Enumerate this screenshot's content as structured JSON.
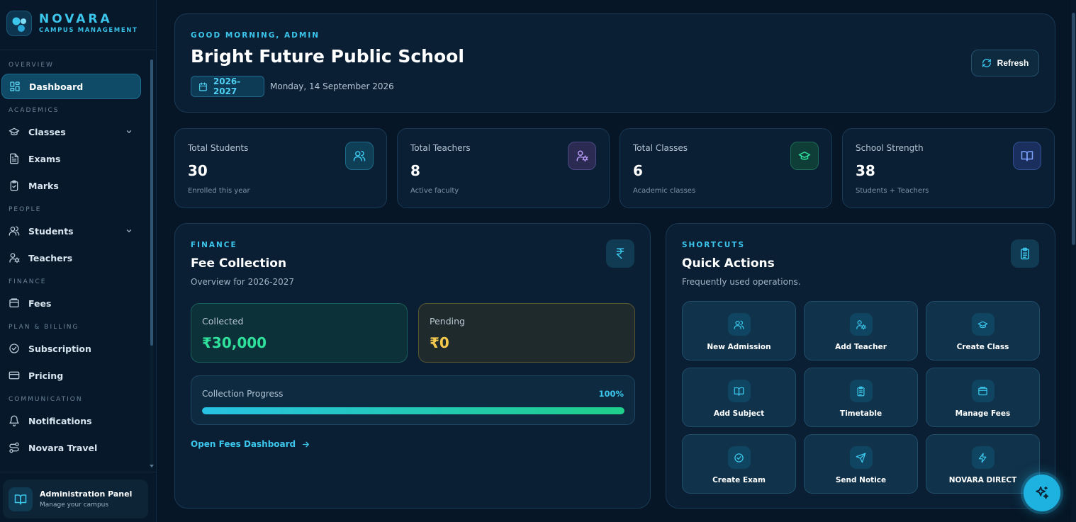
{
  "brand": {
    "name": "NOVARA",
    "subtitle": "CAMPUS MANAGEMENT"
  },
  "sidebar": {
    "sections": [
      {
        "label": "OVERVIEW",
        "items": [
          {
            "label": "Dashboard",
            "icon": "layout-grid-icon",
            "active": true
          }
        ]
      },
      {
        "label": "ACADEMICS",
        "items": [
          {
            "label": "Classes",
            "icon": "graduation-cap-icon",
            "expandable": true
          },
          {
            "label": "Exams",
            "icon": "file-text-icon"
          },
          {
            "label": "Marks",
            "icon": "clipboard-check-icon"
          }
        ]
      },
      {
        "label": "PEOPLE",
        "items": [
          {
            "label": "Students",
            "icon": "users-icon",
            "expandable": true
          },
          {
            "label": "Teachers",
            "icon": "user-cog-icon"
          }
        ]
      },
      {
        "label": "FINANCE",
        "items": [
          {
            "label": "Fees",
            "icon": "wallet-icon"
          }
        ]
      },
      {
        "label": "PLAN & BILLING",
        "items": [
          {
            "label": "Subscription",
            "icon": "check-circle-icon"
          },
          {
            "label": "Pricing",
            "icon": "credit-card-icon"
          }
        ]
      },
      {
        "label": "COMMUNICATION",
        "items": [
          {
            "label": "Notifications",
            "icon": "bell-icon"
          },
          {
            "label": "Novara Travel",
            "icon": "route-icon"
          }
        ]
      }
    ]
  },
  "admin_panel": {
    "title": "Administration Panel",
    "subtitle": "Manage your campus"
  },
  "hero": {
    "greeting": "GOOD MORNING, ADMIN",
    "school_name": "Bright Future Public School",
    "academic_year": "2026-2027",
    "date": "Monday, 14 September 2026",
    "refresh_label": "Refresh"
  },
  "stats": [
    {
      "label": "Total Students",
      "value": "30",
      "sub": "Enrolled this year",
      "icon": "users-icon",
      "color": "#3cc6ec",
      "bg": "#0f3f57",
      "border": "#1f6a8a"
    },
    {
      "label": "Total Teachers",
      "value": "8",
      "sub": "Active faculty",
      "icon": "user-cog-icon",
      "color": "#b69af5",
      "bg": "#2a2a52",
      "border": "#4a4a86"
    },
    {
      "label": "Total Classes",
      "value": "6",
      "sub": "Academic classes",
      "icon": "graduation-cap-icon",
      "color": "#2ee29c",
      "bg": "#0f3d38",
      "border": "#1e6b58"
    },
    {
      "label": "School Strength",
      "value": "38",
      "sub": "Students + Teachers",
      "icon": "book-open-icon",
      "color": "#7ea4ff",
      "bg": "#1b2f5e",
      "border": "#324f92"
    }
  ],
  "finance": {
    "overline": "FINANCE",
    "title": "Fee Collection",
    "subtitle": "Overview for 2026-2027",
    "icon": "rupee-icon",
    "collected_label": "Collected",
    "collected_value": "₹30,000",
    "pending_label": "Pending",
    "pending_value": "₹0",
    "progress_label": "Collection Progress",
    "progress_text": "100%",
    "progress_fraction": 1.0,
    "link_label": "Open Fees Dashboard"
  },
  "shortcuts": {
    "overline": "SHORTCUTS",
    "title": "Quick Actions",
    "subtitle": "Frequently used operations.",
    "icon": "clipboard-list-icon",
    "actions": [
      {
        "label": "New Admission",
        "icon": "users-icon"
      },
      {
        "label": "Add Teacher",
        "icon": "user-cog-icon"
      },
      {
        "label": "Create Class",
        "icon": "graduation-cap-icon"
      },
      {
        "label": "Add Subject",
        "icon": "book-open-icon"
      },
      {
        "label": "Timetable",
        "icon": "clipboard-list-icon"
      },
      {
        "label": "Manage Fees",
        "icon": "wallet-icon"
      },
      {
        "label": "Create Exam",
        "icon": "check-circle-icon"
      },
      {
        "label": "Send Notice",
        "icon": "send-icon"
      },
      {
        "label": "NOVARA DIRECT",
        "icon": "zap-icon"
      }
    ]
  },
  "fab": {
    "icon": "sparkles-icon"
  },
  "colors": {
    "accent": "#3cc6ec",
    "success": "#2ee29c",
    "warning": "#f4c94c",
    "background": "#061626"
  }
}
